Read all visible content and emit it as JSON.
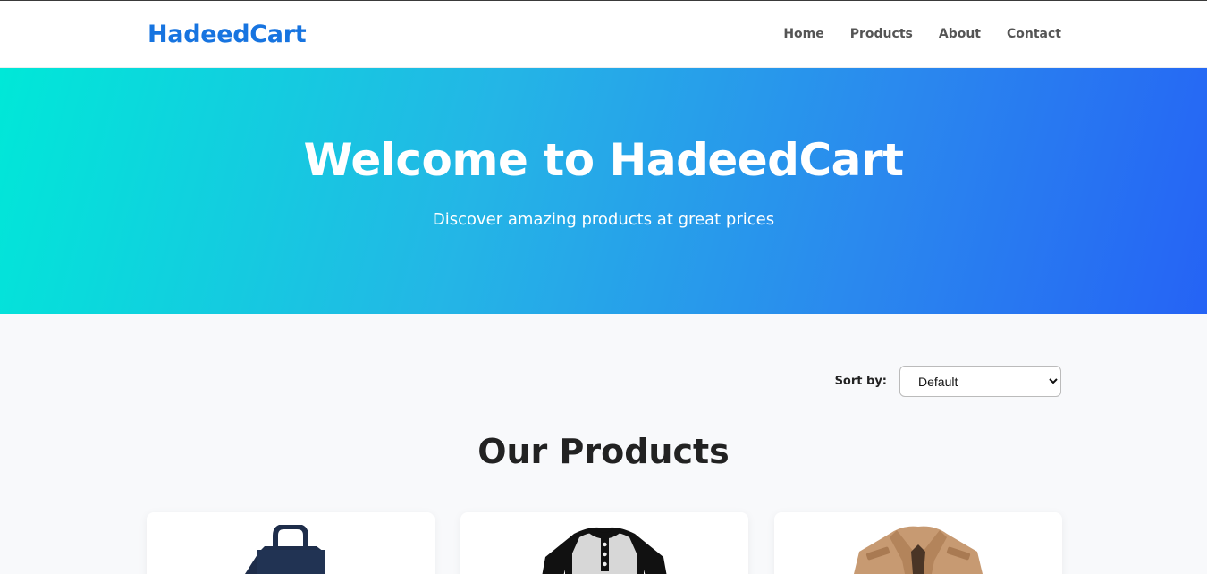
{
  "header": {
    "logo": "HadeedCart",
    "nav": [
      {
        "label": "Home"
      },
      {
        "label": "Products"
      },
      {
        "label": "About"
      },
      {
        "label": "Contact"
      }
    ]
  },
  "hero": {
    "title": "Welcome to HadeedCart",
    "subtitle": "Discover amazing products at great prices"
  },
  "sort": {
    "label": "Sort by:",
    "selected": "Default"
  },
  "products_section": {
    "title": "Our Products",
    "items": [
      {
        "image": "navy-tote-bag"
      },
      {
        "image": "raglan-henley-shirt"
      },
      {
        "image": "khaki-jacket"
      }
    ]
  },
  "colors": {
    "brand": "#1774e0",
    "hero_gradient_start": "#00e8d8",
    "hero_gradient_end": "#2563f5"
  }
}
